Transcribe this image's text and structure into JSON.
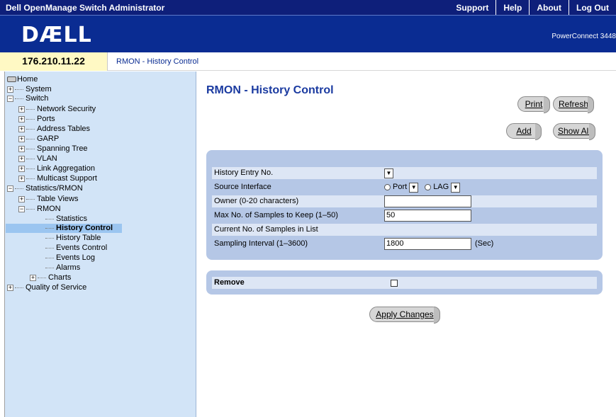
{
  "header": {
    "app_title": "Dell OpenManage Switch Administrator",
    "nav": [
      "Support",
      "Help",
      "About",
      "Log Out"
    ],
    "logo": "DÆLL",
    "product": "PowerConnect 3448"
  },
  "address": {
    "ip": "176.210.11.22",
    "breadcrumb": "RMON - History Control"
  },
  "tree": {
    "home": "Home",
    "system": "System",
    "switch": "Switch",
    "network_security": "Network Security",
    "ports": "Ports",
    "address_tables": "Address Tables",
    "garp": "GARP",
    "spanning_tree": "Spanning Tree",
    "vlan": "VLAN",
    "link_aggregation": "Link Aggregation",
    "multicast_support": "Multicast Support",
    "statistics_rmon": "Statistics/RMON",
    "table_views": "Table Views",
    "rmon": "RMON",
    "statistics": "Statistics",
    "history_control": "History Control",
    "history_table": "History Table",
    "events_control": "Events Control",
    "events_log": "Events Log",
    "alarms": "Alarms",
    "charts": "Charts",
    "qos": "Quality of Service"
  },
  "page": {
    "title": "RMON - History Control",
    "buttons": {
      "print": "Print",
      "refresh": "Refresh",
      "add": "Add",
      "show_all": "Show All",
      "apply": "Apply Changes"
    }
  },
  "form": {
    "history_entry_label": "History Entry No.",
    "source_interface_label": "Source Interface",
    "port_label": "Port",
    "lag_label": "LAG",
    "owner_label": "Owner (0-20 characters)",
    "owner_value": "",
    "max_samples_label": "Max No. of Samples to Keep (1–50)",
    "max_samples_value": "50",
    "current_samples_label": "Current No. of Samples in List",
    "sampling_interval_label": "Sampling Interval (1–3600)",
    "sampling_interval_value": "1800",
    "sec_unit": "(Sec)",
    "remove_label": "Remove"
  }
}
